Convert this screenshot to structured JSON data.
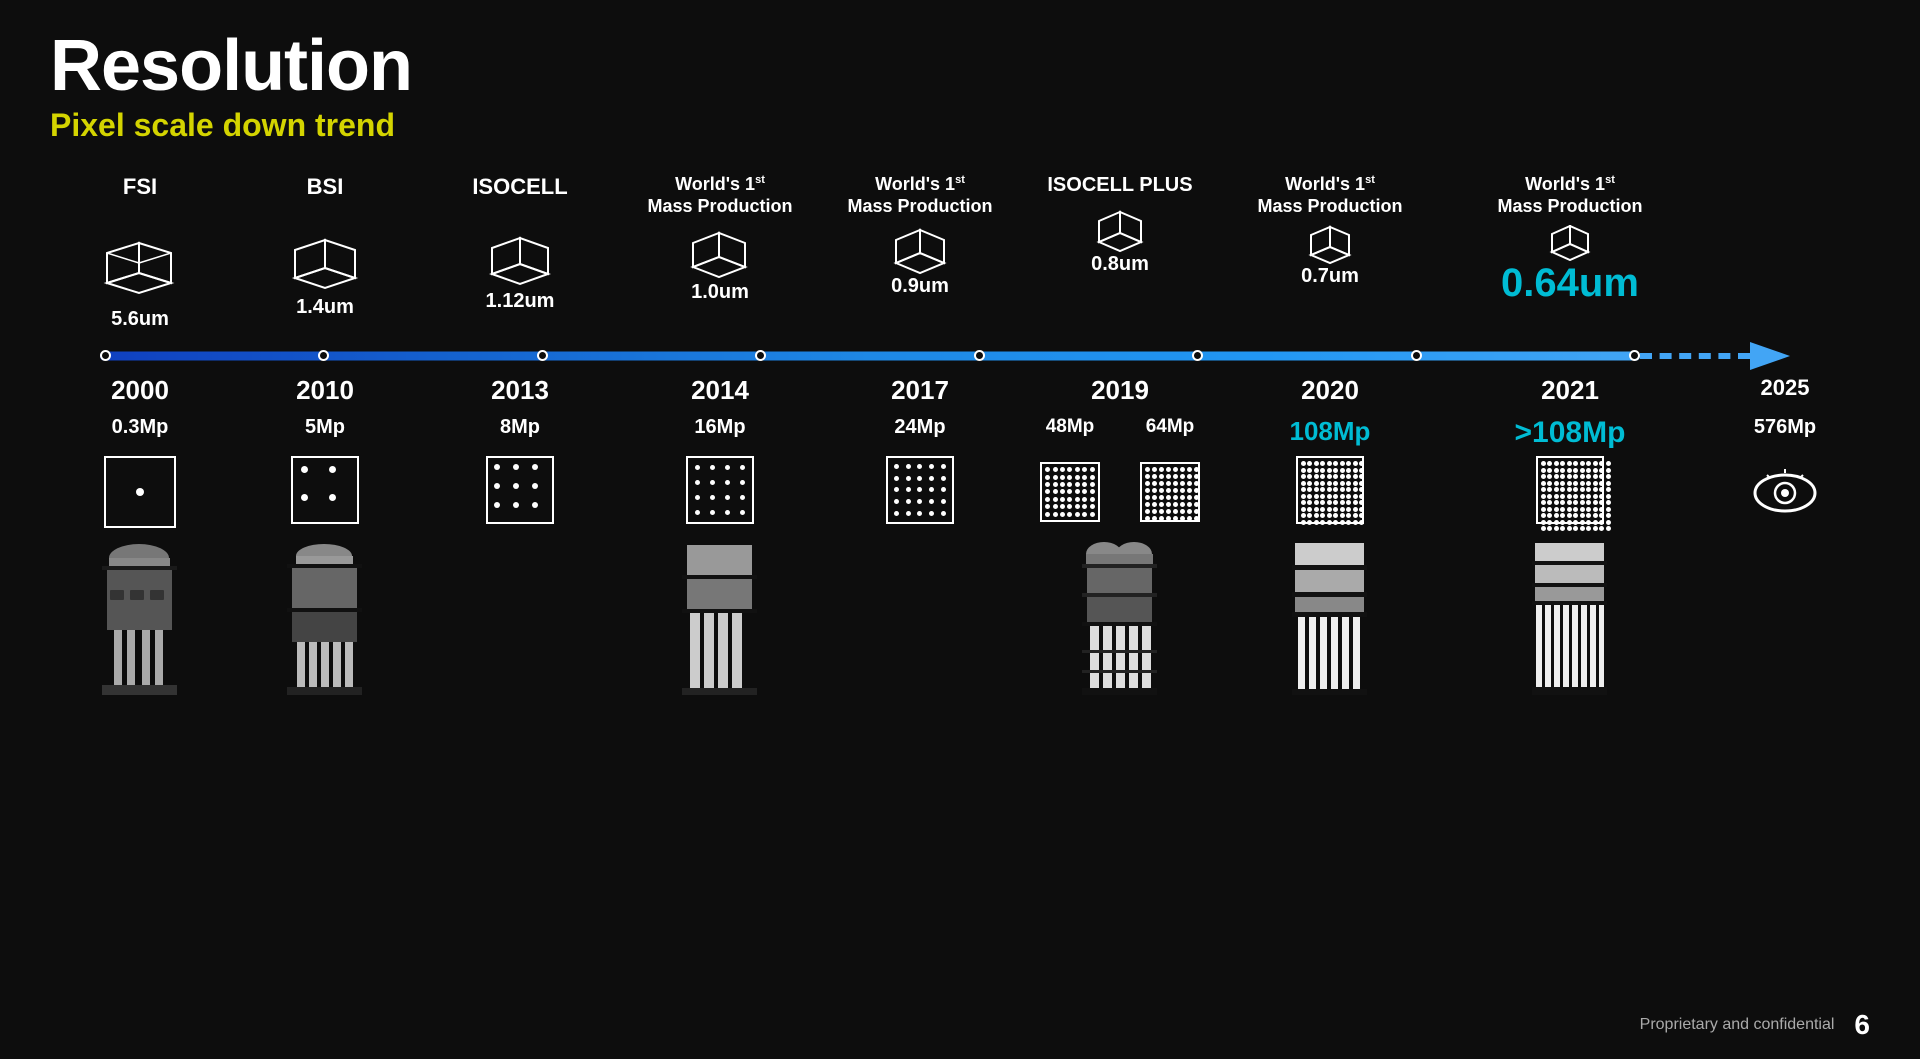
{
  "title": "Resolution",
  "subtitle": "Pixel scale down trend",
  "footer": {
    "text": "Proprietary and confidential",
    "page": "6"
  },
  "columns": [
    {
      "id": "fsi",
      "tech": "FSI",
      "world_label": null,
      "pixel_size": "5.6um",
      "cube_size": "large",
      "year": "2000",
      "mp": "0.3Mp",
      "grid": {
        "rows": 1,
        "cols": 1
      },
      "has_cross": true
    },
    {
      "id": "bsi",
      "tech": "BSI",
      "world_label": null,
      "pixel_size": "1.4um",
      "cube_size": "medium",
      "year": "2010",
      "mp": "5Mp",
      "grid": {
        "rows": 2,
        "cols": 2
      },
      "has_cross": true
    },
    {
      "id": "isocell",
      "tech": "ISOCELL",
      "world_label": null,
      "pixel_size": "1.12um",
      "cube_size": "medium",
      "year": "2013",
      "mp": "8Mp",
      "grid": {
        "rows": 3,
        "cols": 3
      },
      "has_cross": false
    },
    {
      "id": "w1st_1",
      "tech": null,
      "world_label": "World's 1st\nMass Production",
      "pixel_size": "1.0um",
      "cube_size": "small",
      "year": "2014",
      "mp": "16Mp",
      "grid": {
        "rows": 4,
        "cols": 4
      },
      "has_cross": true
    },
    {
      "id": "w1st_2",
      "tech": null,
      "world_label": "World's 1st\nMass Production",
      "pixel_size": "0.9um",
      "cube_size": "small",
      "year": "2017",
      "mp": "24Mp",
      "grid": {
        "rows": 5,
        "cols": 5
      },
      "has_cross": false
    },
    {
      "id": "isocell_plus",
      "tech": "ISOCELL PLUS",
      "world_label": null,
      "pixel_size": "0.8um",
      "cube_size": "smaller",
      "year": "2019",
      "mp_pair": [
        "48Mp",
        "64Mp"
      ],
      "grid_pair": [
        {
          "rows": 7,
          "cols": 7
        },
        {
          "rows": 8,
          "cols": 8
        }
      ],
      "has_cross": true
    },
    {
      "id": "w1st_3",
      "tech": null,
      "world_label": "World's 1st\nMass Production",
      "pixel_size": "0.7um",
      "cube_size": "tiny",
      "year": "2020",
      "mp": "108Mp",
      "mp_highlight": "blue",
      "grid": {
        "rows": 10,
        "cols": 10
      },
      "has_cross": true
    },
    {
      "id": "w1st_4",
      "tech": null,
      "world_label": "World's 1st\nMass Production",
      "pixel_size": "0.64um",
      "pixel_highlight": true,
      "cube_size": "tiny",
      "year": "2021",
      "mp": ">108Mp",
      "mp_highlight": "big",
      "grid": {
        "rows": 11,
        "cols": 11
      },
      "has_cross": true
    },
    {
      "id": "future",
      "tech": null,
      "world_label": null,
      "pixel_size": null,
      "cube_size": null,
      "year": "2025",
      "mp": "576Mp",
      "grid": null,
      "eye_icon": true,
      "has_cross": false
    }
  ],
  "timeline": {
    "dots": 9,
    "bar_color": "#1e88e5",
    "arrow_color": "#42a5f5"
  }
}
